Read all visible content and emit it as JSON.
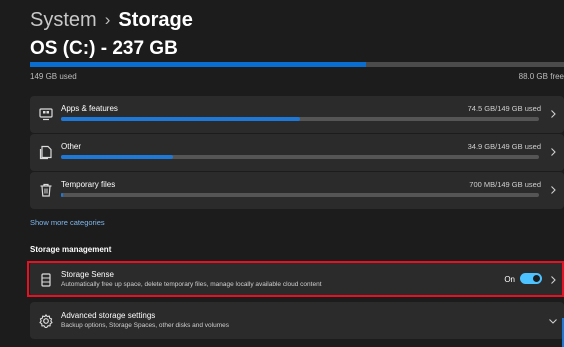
{
  "breadcrumb": {
    "parent": "System",
    "separator": "›",
    "current": "Storage"
  },
  "drive": {
    "title": "OS (C:) - 237 GB",
    "used_label": "149 GB used",
    "free_label": "88.0 GB free",
    "used_fraction": 0.629
  },
  "categories": [
    {
      "name": "Apps & features",
      "size": "74.5 GB/149 GB used",
      "fraction": 0.5,
      "icon": "apps-icon"
    },
    {
      "name": "Other",
      "size": "34.9 GB/149 GB used",
      "fraction": 0.234,
      "icon": "other-file-icon"
    },
    {
      "name": "Temporary files",
      "size": "700 MB/149 GB used",
      "fraction": 0.005,
      "icon": "trash-icon"
    }
  ],
  "show_more": "Show more categories",
  "storage_management": {
    "heading": "Storage management",
    "storage_sense": {
      "title": "Storage Sense",
      "description": "Automatically free up space, delete temporary files, manage locally available cloud content",
      "toggle_label": "On",
      "toggle_on": true
    },
    "advanced": {
      "title": "Advanced storage settings",
      "description": "Backup options, Storage Spaces, other disks and volumes"
    }
  },
  "colors": {
    "accent": "#0a6ed1",
    "toggle": "#4cc2ff",
    "highlight": "#e81123",
    "card": "#2b2b2b",
    "background": "#1c1c1c"
  }
}
